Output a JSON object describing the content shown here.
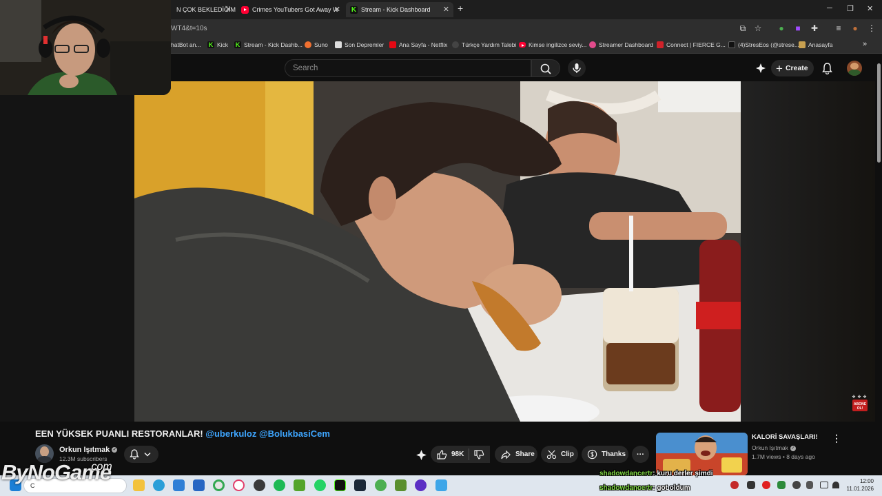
{
  "browser": {
    "tabs": [
      {
        "label": "N ÇOK BEKLEDİĞİM",
        "icon": "none",
        "active": false
      },
      {
        "label": "Crimes YouTubers Got Away W",
        "icon": "youtube-icon",
        "active": false
      },
      {
        "label": "Stream - Kick Dashboard",
        "icon": "kick-icon",
        "active": true
      }
    ],
    "new_tab": "+",
    "url": "WT4&t=10s",
    "bookmarks": [
      {
        "label": "hatBot an...",
        "icon": "none",
        "color": "#2e2e2e"
      },
      {
        "label": "Kick",
        "icon": "kick-icon",
        "color": "#53fc18"
      },
      {
        "label": "Stream - Kick Dashb...",
        "icon": "kick-icon",
        "color": "#53fc18"
      },
      {
        "label": "Suno",
        "icon": "suno-icon",
        "color": "#f07030"
      },
      {
        "label": "Son Depremler",
        "icon": "page-icon",
        "color": "#dddddd"
      },
      {
        "label": "Ana Sayfa - Netflix",
        "icon": "netflix-icon",
        "color": "#e50914"
      },
      {
        "label": "Türkçe Yardım Talebi",
        "icon": "support-icon",
        "color": "#444444"
      },
      {
        "label": "Kimse ingilizce seviy...",
        "icon": "youtube-icon",
        "color": "#ff0033"
      },
      {
        "label": "Streamer Dashboard",
        "icon": "dashboard-icon",
        "color": "#e24b8c"
      },
      {
        "label": "Connect | FIERCE G...",
        "icon": "fierce-icon",
        "color": "#d0222a"
      },
      {
        "label": "(4)StresEos (@strese...",
        "icon": "tiktok-icon",
        "color": "#111111"
      },
      {
        "label": "Anasayfa",
        "icon": "home-icon",
        "color": "#c8a050"
      }
    ],
    "bookmarks_more": "»"
  },
  "youtube": {
    "search_placeholder": "Search",
    "create_label": "Create",
    "video": {
      "title_prefix": "EEN YÜKSEK PUANLI RESTORANLAR! ",
      "title_tags": "@uberkuloz @BolukbasiCem",
      "channel": "Orkun Işıtmak",
      "subscribers": "12.3M subscribers",
      "likes": "98K",
      "share_label": "Share",
      "clip_label": "Clip",
      "thanks_label": "Thanks",
      "more_label": "···",
      "overlay_badge": "ABONE OL!"
    },
    "recommended": {
      "title": "KALORİ SAVAŞLARI!",
      "channel": "Orkun Işıtmak",
      "meta": "1.7M views • 8 days ago"
    }
  },
  "stream_overlay": {
    "brand": "ByNoGame",
    "brand_suffix": ".com",
    "chat": [
      {
        "user": "shadowdancertr",
        "message": ": kuru derler şimdi"
      },
      {
        "user": "shadowdancertr",
        "message": ": got oldum"
      }
    ]
  },
  "taskbar": {
    "search_text": "C",
    "time": "12:00",
    "date": "11.01.2026"
  },
  "colors": {
    "accent": "#3ea6ff",
    "brand_red": "#ff0033",
    "kick_green": "#53fc18"
  }
}
